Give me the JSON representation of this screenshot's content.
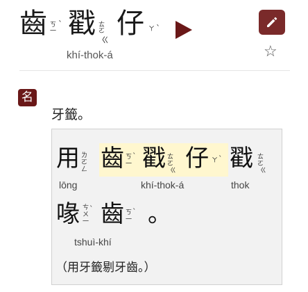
{
  "headword": {
    "chars": [
      "齒",
      "戳",
      "仔"
    ],
    "zhuyin": [
      [
        "ㄎ",
        "一"
      ],
      [
        "ㄊ",
        "ㄛ"
      ],
      [
        "ㄚ"
      ]
    ],
    "tone_marks": [
      "ˋ",
      "ˋ",
      "ˋ"
    ],
    "stop_marks": [
      "ㄍ"
    ],
    "romanization": "khí-thok-á"
  },
  "toolbar": {
    "play_icon": "play-triangle",
    "edit_icon": "pencil-icon",
    "star_icon": "star-outline",
    "accent_color": "#6a1818"
  },
  "entry": {
    "pos_label": "名",
    "definition": "牙籤。",
    "example": {
      "line1_chars": [
        "用",
        "齒",
        "戳",
        "仔",
        "戳"
      ],
      "line2_chars": [
        "喙",
        "齒",
        "。"
      ],
      "romanizations": {
        "yong": "lōng",
        "headword": "khí-thok-á",
        "thok": "thok",
        "tshuikhi": "tshuì-khí"
      },
      "zhuyin": {
        "yong": [
          "ㄌ",
          "ㄛ",
          "ㄥ"
        ],
        "khi": [
          "ㄎ",
          "一"
        ],
        "thok": [
          "ㄊ",
          "ㄛ"
        ],
        "a": [
          "ㄚ"
        ],
        "thok2": [
          "ㄊ",
          "ㄛ"
        ],
        "tshui": [
          "ㄘ",
          "ㄨ",
          "一"
        ],
        "khi2": [
          "ㄎ",
          "一"
        ]
      },
      "translation": "（用牙籤剔牙齒。）"
    }
  }
}
